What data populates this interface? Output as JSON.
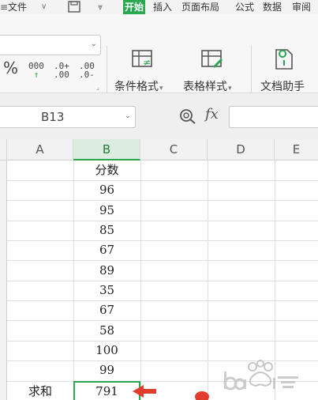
{
  "menubar": {
    "file": "文件",
    "tabs": [
      "开始",
      "插入",
      "页面布局",
      "公式",
      "数据",
      "审阅"
    ],
    "active_index": 0,
    "active_color": "#2aa84f"
  },
  "ribbon": {
    "percent": "%",
    "thousands": "000",
    "inc_decimal_top": ".0+",
    "inc_decimal_bottom": ".00",
    "dec_decimal_top": ".00",
    "dec_decimal_bottom": ".0-",
    "conditional_format": "条件格式",
    "table_style": "表格样式",
    "doc_assistant": "文档助手"
  },
  "formula_bar": {
    "cell_ref": "B13",
    "fx": "fx"
  },
  "columns": [
    "A",
    "B",
    "C",
    "D",
    "E"
  ],
  "selected_column": "B",
  "sheet": {
    "header_b": "分数",
    "scores": [
      "96",
      "95",
      "85",
      "67",
      "89",
      "35",
      "67",
      "58",
      "100",
      "99"
    ],
    "sum_label": "求和",
    "sum_value": "791"
  },
  "colors": {
    "accent": "#2aa84f",
    "arrow": "#e23c2c"
  },
  "icons": [
    "save-icon",
    "dropdown-arrow-icon",
    "conditional-format-icon",
    "table-style-icon",
    "doc-assistant-icon",
    "zoom-icon",
    "red-arrow-icon",
    "watermark-logo"
  ]
}
